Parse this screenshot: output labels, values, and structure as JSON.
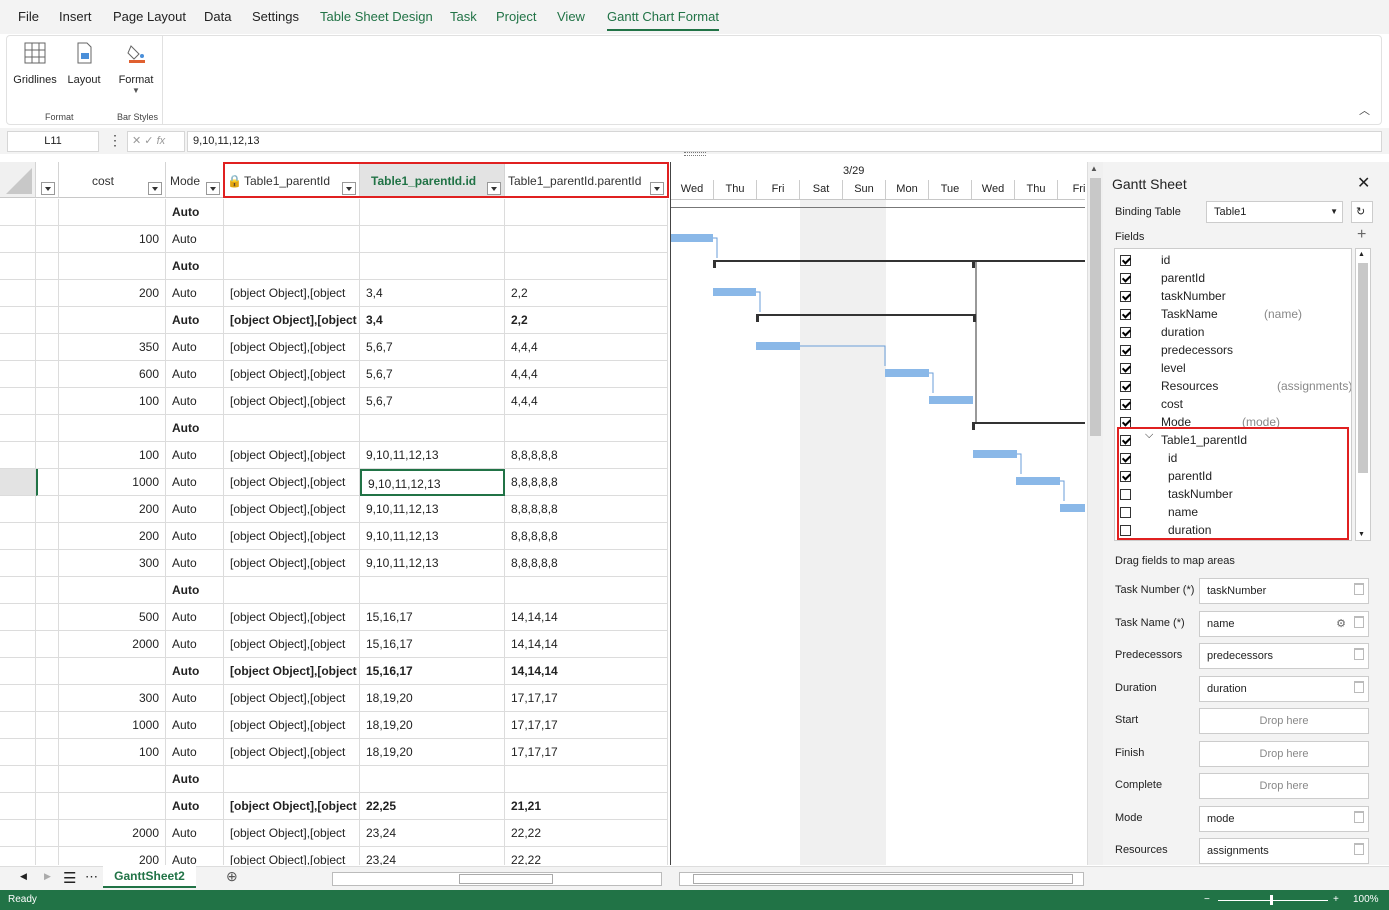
{
  "menu": {
    "items": [
      "File",
      "Insert",
      "Page Layout",
      "Data",
      "Settings",
      "Table Sheet Design",
      "Task",
      "Project",
      "View",
      "Gantt Chart Format"
    ]
  },
  "ribbon": {
    "gridlines": "Gridlines",
    "layout": "Layout",
    "format": "Format",
    "group_format": "Format",
    "group_bar_styles": "Bar Styles"
  },
  "formula": {
    "name_box": "L11",
    "value": "9,10,11,12,13",
    "fx": "fx"
  },
  "grid": {
    "headers": {
      "cost": "cost",
      "mode": "Mode",
      "parent": "Table1_parentId",
      "parent_id": "Table1_parentId.id",
      "parent_parentid": "Table1_parentId.parentId"
    },
    "rows": [
      {
        "cost": "",
        "mode": "Auto",
        "parent": "",
        "pid": "",
        "ppid": "",
        "bold": true
      },
      {
        "cost": "100",
        "mode": "Auto",
        "parent": "",
        "pid": "",
        "ppid": "",
        "bold": false
      },
      {
        "cost": "",
        "mode": "Auto",
        "parent": "",
        "pid": "",
        "ppid": "",
        "bold": true
      },
      {
        "cost": "200",
        "mode": "Auto",
        "parent": "[object Object],[object",
        "pid": "3,4",
        "ppid": "2,2",
        "bold": false
      },
      {
        "cost": "",
        "mode": "Auto",
        "parent": "[object Object],[object",
        "pid": "3,4",
        "ppid": "2,2",
        "bold": true
      },
      {
        "cost": "350",
        "mode": "Auto",
        "parent": "[object Object],[object",
        "pid": "5,6,7",
        "ppid": "4,4,4",
        "bold": false
      },
      {
        "cost": "600",
        "mode": "Auto",
        "parent": "[object Object],[object",
        "pid": "5,6,7",
        "ppid": "4,4,4",
        "bold": false
      },
      {
        "cost": "100",
        "mode": "Auto",
        "parent": "[object Object],[object",
        "pid": "5,6,7",
        "ppid": "4,4,4",
        "bold": false
      },
      {
        "cost": "",
        "mode": "Auto",
        "parent": "",
        "pid": "",
        "ppid": "",
        "bold": true
      },
      {
        "cost": "100",
        "mode": "Auto",
        "parent": "[object Object],[object",
        "pid": "9,10,11,12,13",
        "ppid": "8,8,8,8,8",
        "bold": false
      },
      {
        "cost": "1000",
        "mode": "Auto",
        "parent": "[object Object],[object",
        "pid": "9,10,11,12,13",
        "ppid": "8,8,8,8,8",
        "bold": false
      },
      {
        "cost": "200",
        "mode": "Auto",
        "parent": "[object Object],[object",
        "pid": "9,10,11,12,13",
        "ppid": "8,8,8,8,8",
        "bold": false
      },
      {
        "cost": "200",
        "mode": "Auto",
        "parent": "[object Object],[object",
        "pid": "9,10,11,12,13",
        "ppid": "8,8,8,8,8",
        "bold": false
      },
      {
        "cost": "300",
        "mode": "Auto",
        "parent": "[object Object],[object",
        "pid": "9,10,11,12,13",
        "ppid": "8,8,8,8,8",
        "bold": false
      },
      {
        "cost": "",
        "mode": "Auto",
        "parent": "",
        "pid": "",
        "ppid": "",
        "bold": true
      },
      {
        "cost": "500",
        "mode": "Auto",
        "parent": "[object Object],[object",
        "pid": "15,16,17",
        "ppid": "14,14,14",
        "bold": false
      },
      {
        "cost": "2000",
        "mode": "Auto",
        "parent": "[object Object],[object",
        "pid": "15,16,17",
        "ppid": "14,14,14",
        "bold": false
      },
      {
        "cost": "",
        "mode": "Auto",
        "parent": "[object Object],[object",
        "pid": "15,16,17",
        "ppid": "14,14,14",
        "bold": true
      },
      {
        "cost": "300",
        "mode": "Auto",
        "parent": "[object Object],[object",
        "pid": "18,19,20",
        "ppid": "17,17,17",
        "bold": false
      },
      {
        "cost": "1000",
        "mode": "Auto",
        "parent": "[object Object],[object",
        "pid": "18,19,20",
        "ppid": "17,17,17",
        "bold": false
      },
      {
        "cost": "100",
        "mode": "Auto",
        "parent": "[object Object],[object",
        "pid": "18,19,20",
        "ppid": "17,17,17",
        "bold": false
      },
      {
        "cost": "",
        "mode": "Auto",
        "parent": "",
        "pid": "",
        "ppid": "",
        "bold": true
      },
      {
        "cost": "",
        "mode": "Auto",
        "parent": "[object Object],[object",
        "pid": "22,25",
        "ppid": "21,21",
        "bold": true
      },
      {
        "cost": "2000",
        "mode": "Auto",
        "parent": "[object Object],[object",
        "pid": "23,24",
        "ppid": "22,22",
        "bold": false
      },
      {
        "cost": "200",
        "mode": "Auto",
        "parent": "[object Object],[object",
        "pid": "23,24",
        "ppid": "22,22",
        "bold": false
      }
    ]
  },
  "gantt": {
    "date_label": "3/29",
    "days": [
      "Wed",
      "Thu",
      "Fri",
      "Sat",
      "Sun",
      "Mon",
      "Tue",
      "Wed",
      "Thu",
      "Fri"
    ]
  },
  "panel": {
    "title": "Gantt Sheet",
    "binding_label": "Binding Table",
    "binding_value": "Table1",
    "fields_label": "Fields",
    "fields": [
      {
        "name": "id",
        "alias": "",
        "checked": true
      },
      {
        "name": "parentId",
        "alias": "",
        "checked": true
      },
      {
        "name": "taskNumber",
        "alias": "",
        "checked": true
      },
      {
        "name": "TaskName",
        "alias": "(name)",
        "checked": true
      },
      {
        "name": "duration",
        "alias": "",
        "checked": true
      },
      {
        "name": "predecessors",
        "alias": "",
        "checked": true
      },
      {
        "name": "level",
        "alias": "",
        "checked": true
      },
      {
        "name": "Resources",
        "alias": "(assignments)",
        "checked": true
      },
      {
        "name": "cost",
        "alias": "",
        "checked": true
      },
      {
        "name": "Mode",
        "alias": "(mode)",
        "checked": true
      },
      {
        "name": "Table1_parentId",
        "alias": "",
        "checked": true
      },
      {
        "name": "id",
        "alias": "",
        "checked": true
      },
      {
        "name": "parentId",
        "alias": "",
        "checked": true
      },
      {
        "name": "taskNumber",
        "alias": "",
        "checked": false
      },
      {
        "name": "name",
        "alias": "",
        "checked": false
      },
      {
        "name": "duration",
        "alias": "",
        "checked": false
      }
    ],
    "drag_label": "Drag fields to map areas",
    "map": [
      {
        "label": "Task Number",
        "req": "(*)",
        "value": "taskNumber",
        "drop": false
      },
      {
        "label": "Task Name",
        "req": "(*)",
        "value": "name",
        "drop": false
      },
      {
        "label": "Predecessors",
        "req": "",
        "value": "predecessors",
        "drop": false
      },
      {
        "label": "Duration",
        "req": "",
        "value": "duration",
        "drop": false
      },
      {
        "label": "Start",
        "req": "",
        "value": "Drop here",
        "drop": true
      },
      {
        "label": "Finish",
        "req": "",
        "value": "Drop here",
        "drop": true
      },
      {
        "label": "Complete",
        "req": "",
        "value": "Drop here",
        "drop": true
      },
      {
        "label": "Mode",
        "req": "",
        "value": "mode",
        "drop": false
      },
      {
        "label": "Resources",
        "req": "",
        "value": "assignments",
        "drop": false
      }
    ]
  },
  "tabs": {
    "sheet": "GanttSheet2"
  },
  "status": {
    "text": "Ready",
    "zoom": "100%"
  },
  "colors": {
    "accent": "#217346",
    "highlight": "#e02020",
    "bar": "#8ab8e8"
  }
}
